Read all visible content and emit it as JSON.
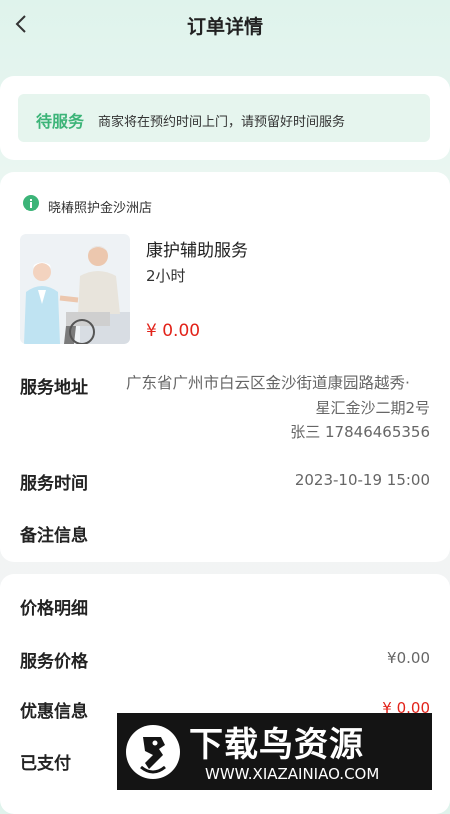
{
  "header": {
    "title": "订单详情"
  },
  "status": {
    "label": "待服务",
    "desc": "商家将在预约时间上门，请预留好时间服务"
  },
  "order": {
    "store_name": "晓椿照护金沙洲店",
    "service_name": "康护辅助服务",
    "service_duration": "2小时",
    "service_price": "¥ 0.00",
    "address_label": "服务地址",
    "address_line1": "广东省广州市白云区金沙街道康园路越秀·",
    "address_line2": "星汇金沙二期2号",
    "address_line3": "张三 17846465356",
    "time_label": "服务时间",
    "time_value": "2023-10-19 15:00",
    "note_label": "备注信息"
  },
  "price_detail": {
    "title": "价格明细",
    "service_price_label": "服务价格",
    "service_price_value": "¥0.00",
    "discount_label": "优惠信息",
    "discount_value": "¥ 0.00",
    "paid_label": "已支付"
  },
  "watermark": {
    "main": "下载鸟资源",
    "url": "WWW.XIAZAINIAO.COM"
  },
  "colors": {
    "accent_green": "#3cb478",
    "price_red": "#e2231a"
  }
}
